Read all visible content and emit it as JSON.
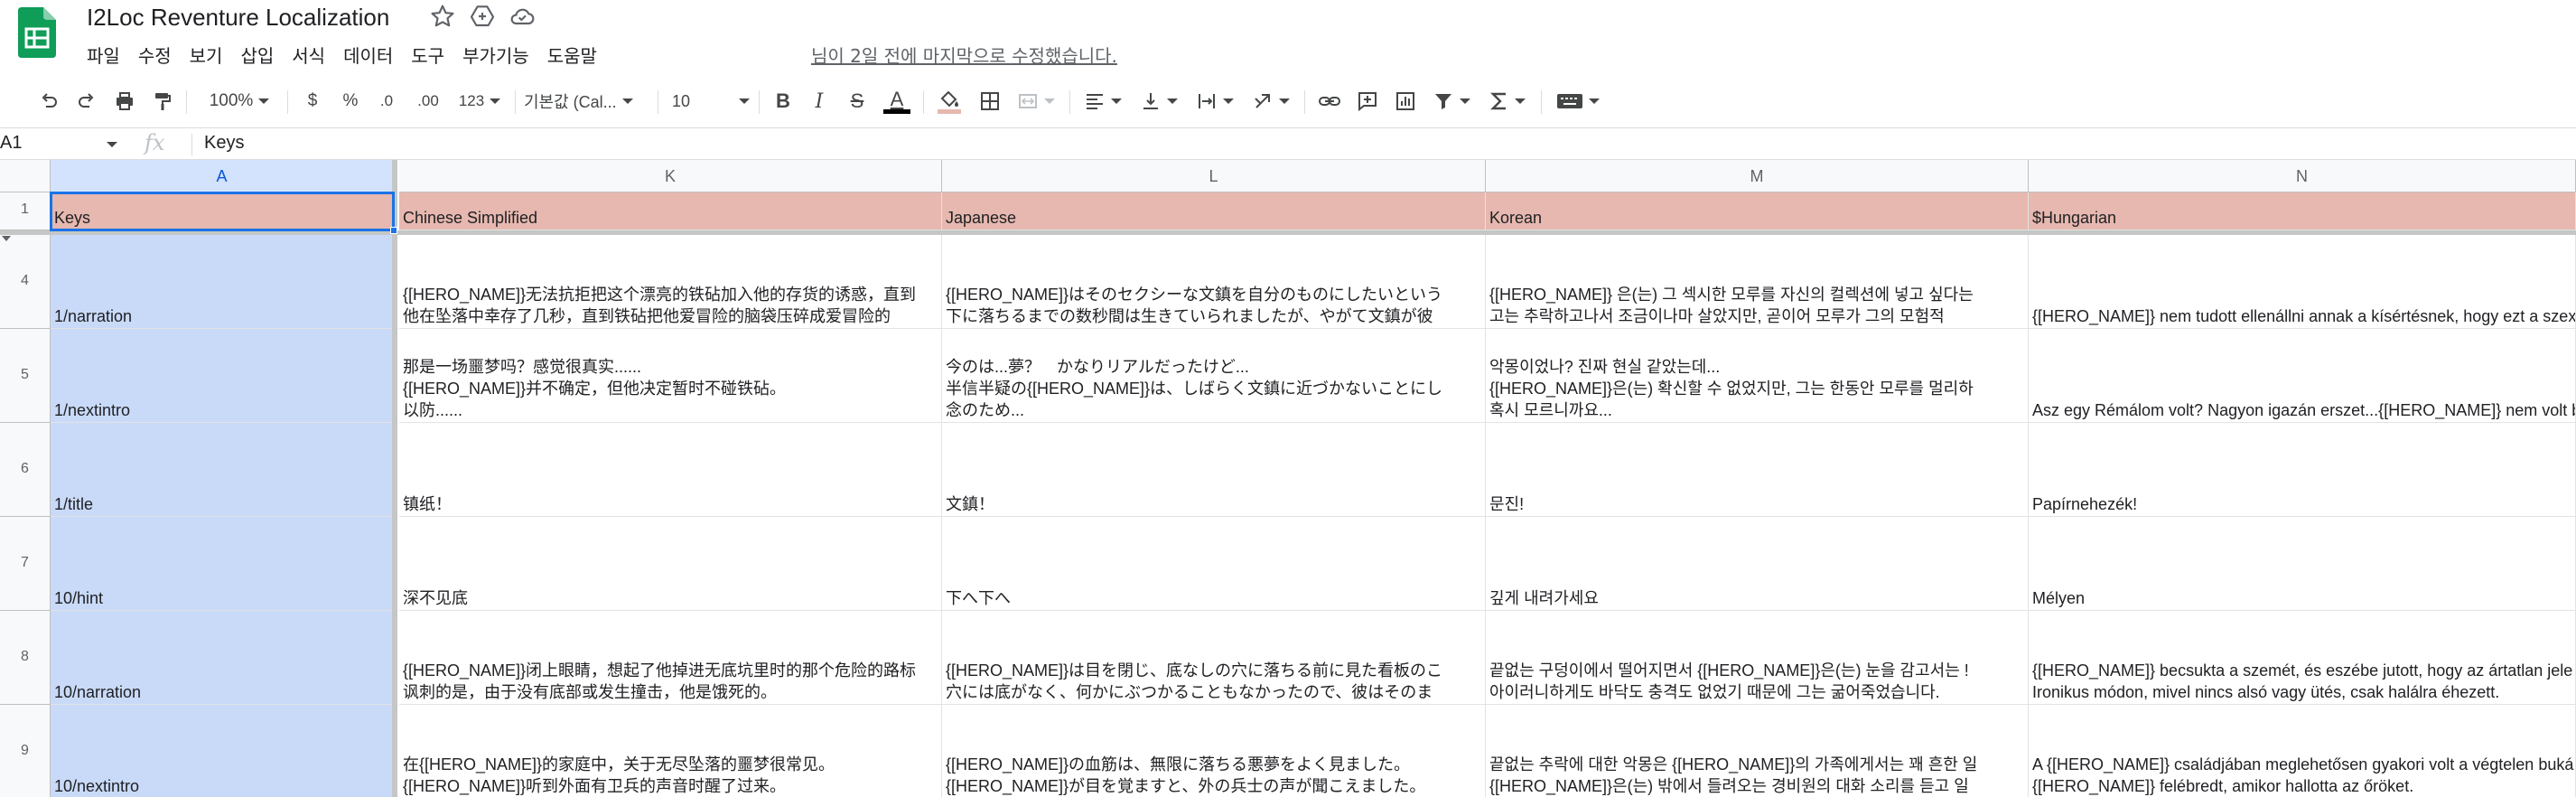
{
  "app": {
    "title": "I2Loc Reventure Localization",
    "last_edit": "님이 2일 전에 마지막으로 수정했습니다.",
    "brand_color": "#0f9d58"
  },
  "menu": [
    "파일",
    "수정",
    "보기",
    "삽입",
    "서식",
    "데이터",
    "도구",
    "부가기능",
    "도움말"
  ],
  "toolbar": {
    "zoom": "100%",
    "currency": "$",
    "percent": "%",
    "decrease_decimals": ".0",
    "increase_decimals": ".00",
    "more_formats": "123",
    "font": "기본값 (Cal...",
    "font_size": "10",
    "bold": "B",
    "italic": "I",
    "strikethrough": "S",
    "text_color": "A",
    "text_color_bar": "#000000",
    "fill_color_bar": "#e6b8af"
  },
  "formula_bar": {
    "cell_ref": "A1",
    "fx": "fx",
    "value": "Keys"
  },
  "grid": {
    "colors": {
      "key_column": "#c9daf8",
      "header_row": "#e6b8af",
      "selection": "#1a73e8"
    },
    "columns": [
      "A",
      "K",
      "L",
      "M",
      "N"
    ],
    "header_row": {
      "number": "1",
      "cells": [
        "Keys",
        "Chinese Simplified",
        "Japanese",
        "Korean",
        "$Hungarian"
      ]
    },
    "rows": [
      {
        "number": "4",
        "cells": [
          [
            "1/narration"
          ],
          [
            "{[HERO_NAME]}无法抗拒把这个漂亮的铁砧加入他的存货的诱惑，直到",
            "他在坠落中幸存了几秒，直到铁砧把他爱冒险的脑袋压碎成爱冒险的"
          ],
          [
            "{[HERO_NAME]}はそのセクシーな文鎮を自分のものにしたいという",
            "下に落ちるまでの数秒間は生きていられましたが、やがて文鎮が彼"
          ],
          [
            "{[HERO_NAME]} 은(는) 그 섹시한 모루를 자신의 컬렉션에 넣고 싶다는",
            "고는 추락하고나서 조금이나마 살았지만, 곧이어 모루가 그의 모험적"
          ],
          [
            "{[HERO_NAME]} nem tudott ellenállni annak a kísértésnek, hogy ezt a szexi"
          ]
        ]
      },
      {
        "number": "5",
        "cells": [
          [
            "1/nextintro"
          ],
          [
            "那是一场噩梦吗？感觉很真实......",
            "{[HERO_NAME]}并不确定，但他决定暂时不碰铁砧。",
            "以防......"
          ],
          [
            "今のは...夢？　かなりリアルだったけど...",
            "半信半疑の{[HERO_NAME]}は、しばらく文鎮に近づかないことにし",
            "念のため..."
          ],
          [
            "악몽이었나? 진짜 현실 같았는데...",
            "{[HERO_NAME]}은(는) 확신할 수 없었지만, 그는 한동안 모루를 멀리하",
            "혹시 모르니까요..."
          ],
          [
            "Asz egy Rémálom volt? Nagyon igazán erszet...{[HERO_NAME]} nem volt b"
          ]
        ]
      },
      {
        "number": "6",
        "cells": [
          [
            "1/title"
          ],
          [
            "镇纸！"
          ],
          [
            "文鎮！"
          ],
          [
            "문진!"
          ],
          [
            "Papírnehezék!"
          ]
        ]
      },
      {
        "number": "7",
        "cells": [
          [
            "10/hint"
          ],
          [
            "深不见底"
          ],
          [
            "下へ下へ"
          ],
          [
            "깊게 내려가세요"
          ],
          [
            "Mélyen"
          ]
        ]
      },
      {
        "number": "8",
        "cells": [
          [
            "10/narration"
          ],
          [
            "{[HERO_NAME]}闭上眼睛，想起了他掉进无底坑里时的那个危险的路标",
            "讽刺的是，由于没有底部或发生撞击，他是饿死的。"
          ],
          [
            "{[HERO_NAME]}は目を閉じ、底なしの穴に落ちる前に見た看板のこ",
            "穴には底がなく、何かにぶつかることもなかったので、彼はそのま"
          ],
          [
            "끝없는 구덩이에서 떨어지면서 {[HERO_NAME]}은(는) 눈을 감고서는 !",
            "아이러니하게도 바닥도 충격도 없었기 때문에 그는 굶어죽었습니다."
          ],
          [
            "{[HERO_NAME]} becsukta a szemét, és eszébe jutott, hogy az ártatlan jele",
            "Ironikus módon, mivel nincs alsó vagy ütés, csak halálra éhezett."
          ]
        ]
      },
      {
        "number": "9",
        "cells": [
          [
            "10/nextintro"
          ],
          [
            "在{[HERO_NAME]}的家庭中，关于无尽坠落的噩梦很常见。",
            "{[HERO_NAME]}听到外面有卫兵的声音时醒了过来。"
          ],
          [
            "{[HERO_NAME]}の血筋は、無限に落ちる悪夢をよく見ました。",
            "{[HERO_NAME]}が目を覚ますと、外の兵士の声が聞こえました。"
          ],
          [
            "끝없는 추락에 대한 악몽은 {[HERO_NAME]}의 가족에게서는 꽤 흔한 일",
            "{[HERO_NAME]}은(는) 밖에서 들려오는 경비원의 대화 소리를 듣고 일"
          ],
          [
            "A {[HERO_NAME]} családjában meglehetősen gyakori volt a végtelen buká",
            "{[HERO_NAME]} felébredt, amikor hallotta az őröket."
          ]
        ]
      }
    ]
  }
}
